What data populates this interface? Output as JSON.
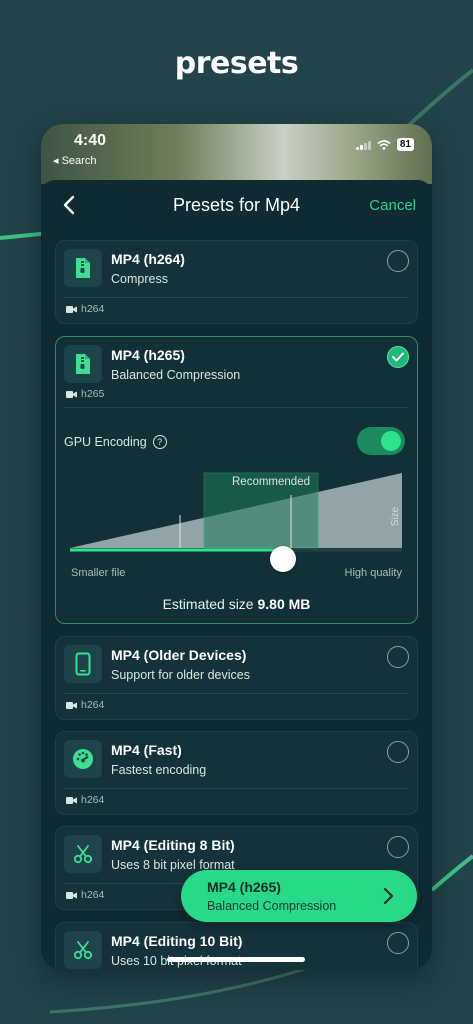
{
  "hero": {
    "title": "presets"
  },
  "status_bar": {
    "time": "4:40",
    "back_label": "◂ Search",
    "battery": "81"
  },
  "nav": {
    "title": "Presets for Mp4",
    "cancel_label": "Cancel"
  },
  "presets": [
    {
      "title": "MP4 (h264)",
      "subtitle": "Compress",
      "codec": "h264",
      "icon": "zip-file-icon",
      "selected": false
    },
    {
      "title": "MP4 (h265)",
      "subtitle": "Balanced Compression",
      "codec": "h265",
      "icon": "zip-file-icon",
      "selected": true
    },
    {
      "title": "MP4 (Older Devices)",
      "subtitle": "Support for older devices",
      "codec": "h264",
      "icon": "phone-icon",
      "selected": false
    },
    {
      "title": "MP4 (Fast)",
      "subtitle": "Fastest encoding",
      "codec": "h264",
      "icon": "speedometer-icon",
      "selected": false
    },
    {
      "title": "MP4 (Editing 8 Bit)",
      "subtitle": "Uses 8 bit pixel format",
      "codec": "h264",
      "icon": "scissors-icon",
      "selected": false
    },
    {
      "title": "MP4 (Editing 10 Bit)",
      "subtitle": "Uses 10 bit pixel format",
      "codec": "",
      "icon": "scissors-icon",
      "selected": false
    }
  ],
  "settings": {
    "gpu_label": "GPU Encoding",
    "gpu_enabled": true,
    "recommended_label": "Recommended",
    "size_axis_label": "Size",
    "left_label": "Smaller file",
    "right_label": "High quality",
    "estimate_prefix": "Estimated size",
    "estimate_value": "9.80 MB",
    "quality_level": 0.61
  },
  "selected_button": {
    "title": "MP4 (h265)",
    "subtitle": "Balanced Compression"
  },
  "colors": {
    "accent": "#2ed28c",
    "background": "#21434a",
    "card": "#143239",
    "button": "#28d98a"
  }
}
